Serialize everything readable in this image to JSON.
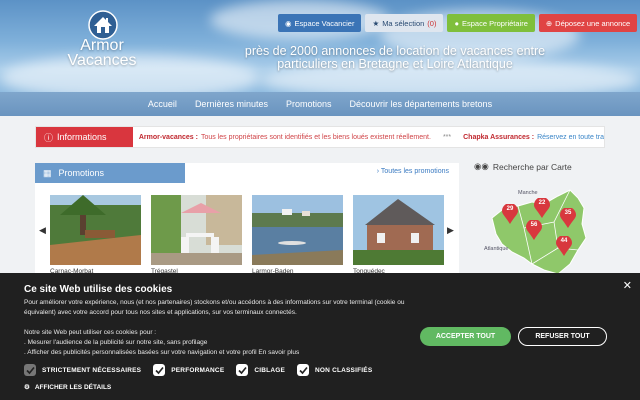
{
  "logo": {
    "line1": "Armor",
    "line2": "Vacances"
  },
  "top_buttons": [
    {
      "label": "Espace Vacancier",
      "icon": "camera-icon"
    },
    {
      "label": "Ma sélection",
      "count": "(0)",
      "icon": "star-icon"
    },
    {
      "label": "Espace Propriétaire",
      "icon": "user-icon"
    },
    {
      "label": "Déposez une annonce",
      "icon": "plus-circle-icon"
    }
  ],
  "tagline": {
    "line1": "près de 2000 annonces de location de vacances entre",
    "line2": "particuliers en Bretagne et Loire Atlantique"
  },
  "nav": [
    "Accueil",
    "Dernières minutes",
    "Promotions",
    "Découvrir les départements bretons"
  ],
  "info": {
    "label": "Informations",
    "msg1_title": "Armor-vacances :",
    "msg1_text": "Tous les propriétaires sont identifiés et les biens loués existent réellement.",
    "separator": "***",
    "msg2_title": "Chapka Assurances :",
    "msg2_text": "Réservez en toute tra"
  },
  "promotions": {
    "title": "Promotions",
    "all_link": "Toutes les promotions",
    "cards": [
      {
        "title": "Carnac-Morbat"
      },
      {
        "title": "Trégastel"
      },
      {
        "title": "Larmor-Baden"
      },
      {
        "title": "Tonquédec"
      }
    ]
  },
  "map": {
    "title": "Recherche par Carte",
    "label_manche": "Manche",
    "label_atlantique": "Atlantique",
    "pins": [
      {
        "dept": "29"
      },
      {
        "dept": "22"
      },
      {
        "dept": "35"
      },
      {
        "dept": "56"
      },
      {
        "dept": "44"
      }
    ],
    "colors": {
      "land": "#8fc86a",
      "sea": "#ffffff",
      "pin": "#d8383e"
    }
  },
  "cookie": {
    "title": "Ce site Web utilise des cookies",
    "p1": "Pour améliorer votre expérience, nous (et nos partenaires) stockons et/ou accédons à des informations sur votre terminal (cookie ou",
    "p2": "équivalent) avec votre accord pour tous nos sites et applications, sur vos terminaux connectés.",
    "p3": "Notre site Web peut utiliser ces cookies pour :",
    "p4": ". Mesurer l'audience de la publicité sur notre site, sans profilage",
    "p5": ". Afficher des publicités personnalisées basées sur votre navigation et votre profil En savoir plus",
    "accept": "ACCEPTER TOUT",
    "refuse": "REFUSER TOUT",
    "checks": [
      {
        "label": "STRICTEMENT NÉCESSAIRES",
        "checked": true,
        "disabled": true
      },
      {
        "label": "PERFORMANCE",
        "checked": true
      },
      {
        "label": "CIBLAGE",
        "checked": true
      },
      {
        "label": "NON CLASSIFIÉS",
        "checked": true
      }
    ],
    "details": "AFFICHER LES DÉTAILS",
    "colors": {
      "accept": "#61b962",
      "background": "#202020"
    }
  },
  "colors": {
    "accent": "#3b74b6",
    "info_red": "#d9363e",
    "promo_blue": "#6b9bcc"
  }
}
